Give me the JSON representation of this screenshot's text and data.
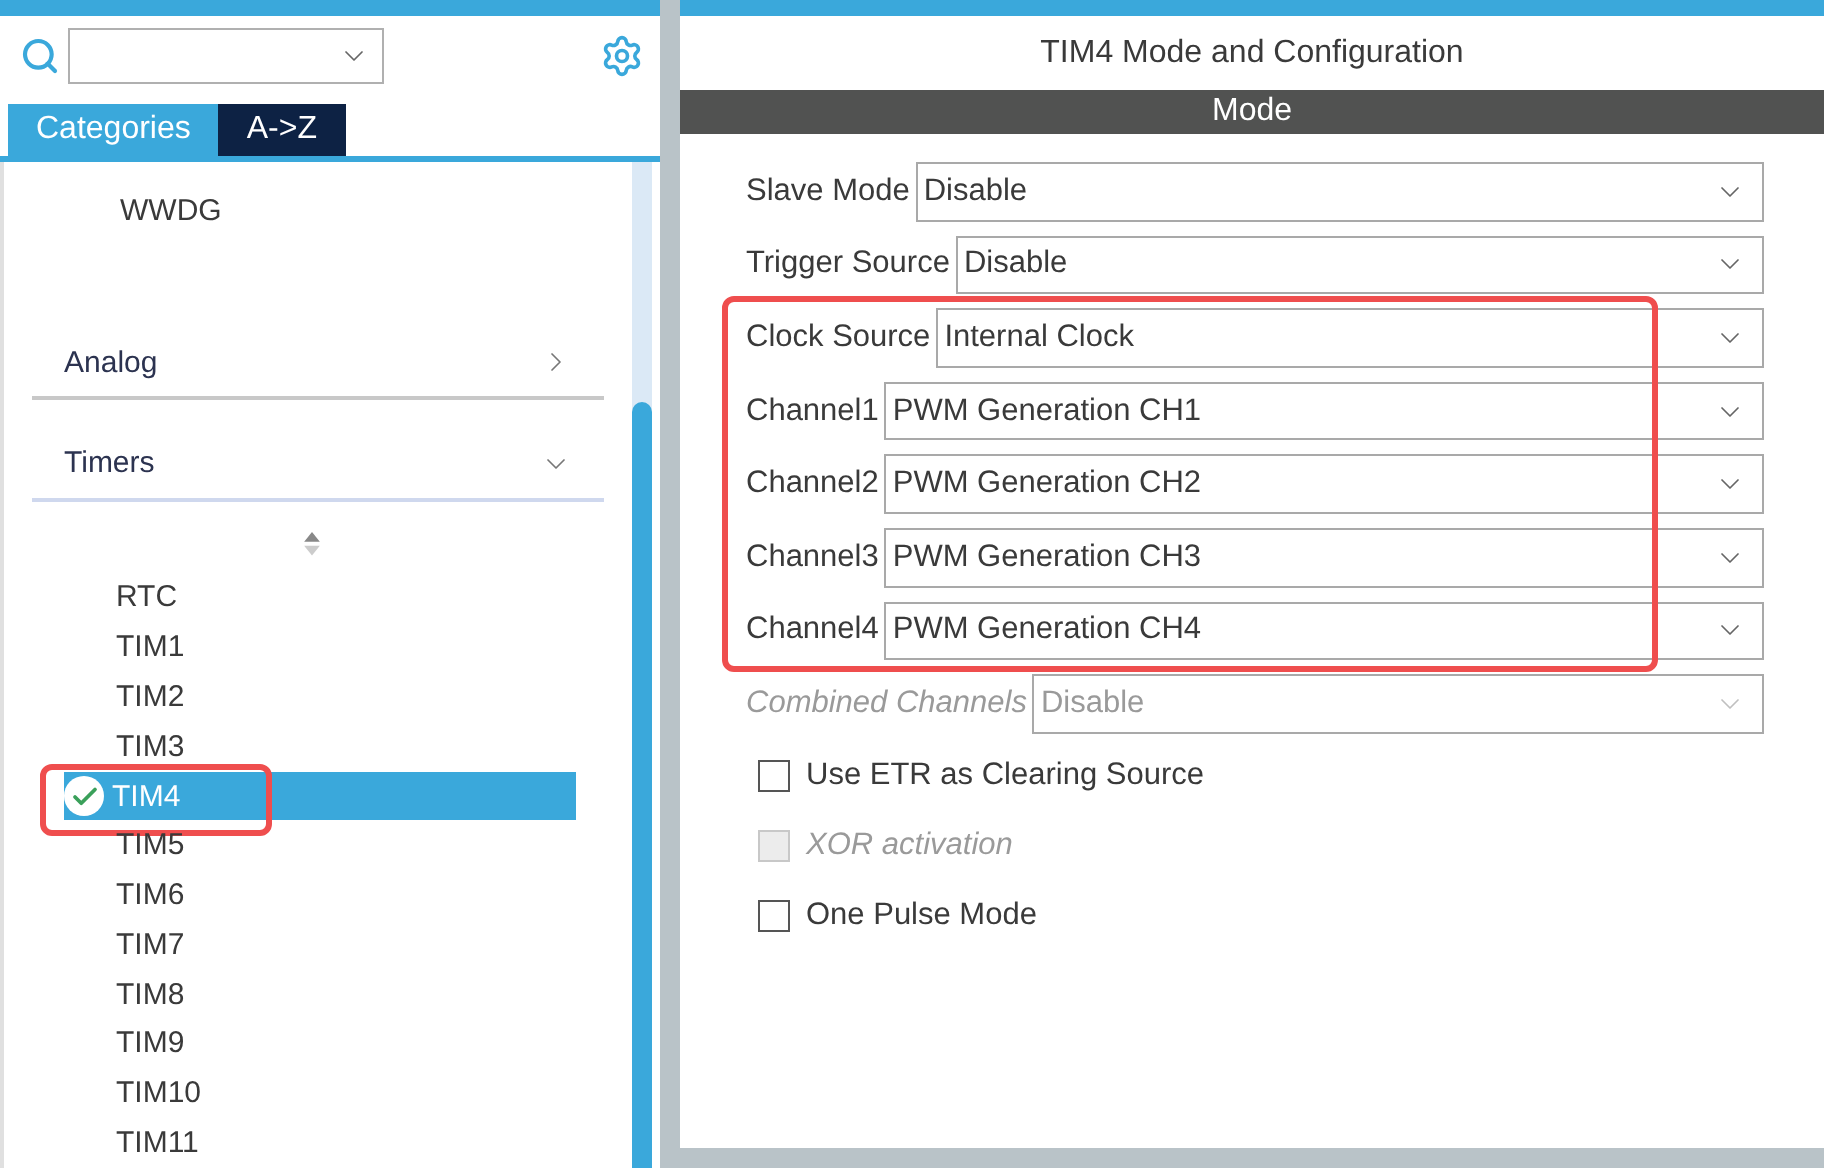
{
  "sidebar": {
    "tabs": [
      {
        "label": "Categories",
        "selected": true
      },
      {
        "label": "A->Z",
        "selected": false
      }
    ],
    "items_top": [
      {
        "label": "WWDG"
      }
    ],
    "categories": [
      {
        "label": "Analog",
        "expanded": false
      },
      {
        "label": "Timers",
        "expanded": true
      }
    ],
    "timers": [
      {
        "label": "RTC",
        "selected": false,
        "checked": false,
        "outlined": false
      },
      {
        "label": "TIM1",
        "selected": false,
        "checked": false,
        "outlined": false
      },
      {
        "label": "TIM2",
        "selected": false,
        "checked": false,
        "outlined": false
      },
      {
        "label": "TIM3",
        "selected": false,
        "checked": false,
        "outlined": false
      },
      {
        "label": "TIM4",
        "selected": true,
        "checked": true,
        "outlined": true
      },
      {
        "label": "TIM5",
        "selected": false,
        "checked": false,
        "outlined": false
      },
      {
        "label": "TIM6",
        "selected": false,
        "checked": false,
        "outlined": false
      },
      {
        "label": "TIM7",
        "selected": false,
        "checked": false,
        "outlined": false
      },
      {
        "label": "TIM8",
        "selected": false,
        "checked": false,
        "outlined": false
      },
      {
        "label": "TIM9",
        "selected": false,
        "checked": false,
        "outlined": false
      },
      {
        "label": "TIM10",
        "selected": false,
        "checked": false,
        "outlined": false
      },
      {
        "label": "TIM11",
        "selected": false,
        "checked": false,
        "outlined": false
      }
    ]
  },
  "panel": {
    "title": "TIM4 Mode and Configuration",
    "section": "Mode",
    "fields": [
      {
        "label": "Slave Mode",
        "value": "Disable",
        "disabled": false,
        "outlined": false
      },
      {
        "label": "Trigger Source",
        "value": "Disable",
        "disabled": false,
        "outlined": false
      },
      {
        "label": "Clock Source",
        "value": "Internal Clock",
        "disabled": false,
        "outlined": true
      },
      {
        "label": "Channel1",
        "value": "PWM Generation CH1",
        "disabled": false,
        "outlined": true
      },
      {
        "label": "Channel2",
        "value": "PWM Generation CH2",
        "disabled": false,
        "outlined": true
      },
      {
        "label": "Channel3",
        "value": "PWM Generation CH3",
        "disabled": false,
        "outlined": true
      },
      {
        "label": "Channel4",
        "value": "PWM Generation CH4",
        "disabled": false,
        "outlined": true
      },
      {
        "label": "Combined Channels",
        "value": "Disable",
        "disabled": true,
        "outlined": false
      }
    ],
    "options": [
      {
        "label": "Use ETR as Clearing Source",
        "checked": false,
        "disabled": false
      },
      {
        "label": "XOR activation",
        "checked": false,
        "disabled": true
      },
      {
        "label": "One Pulse Mode",
        "checked": false,
        "disabled": false
      }
    ]
  }
}
